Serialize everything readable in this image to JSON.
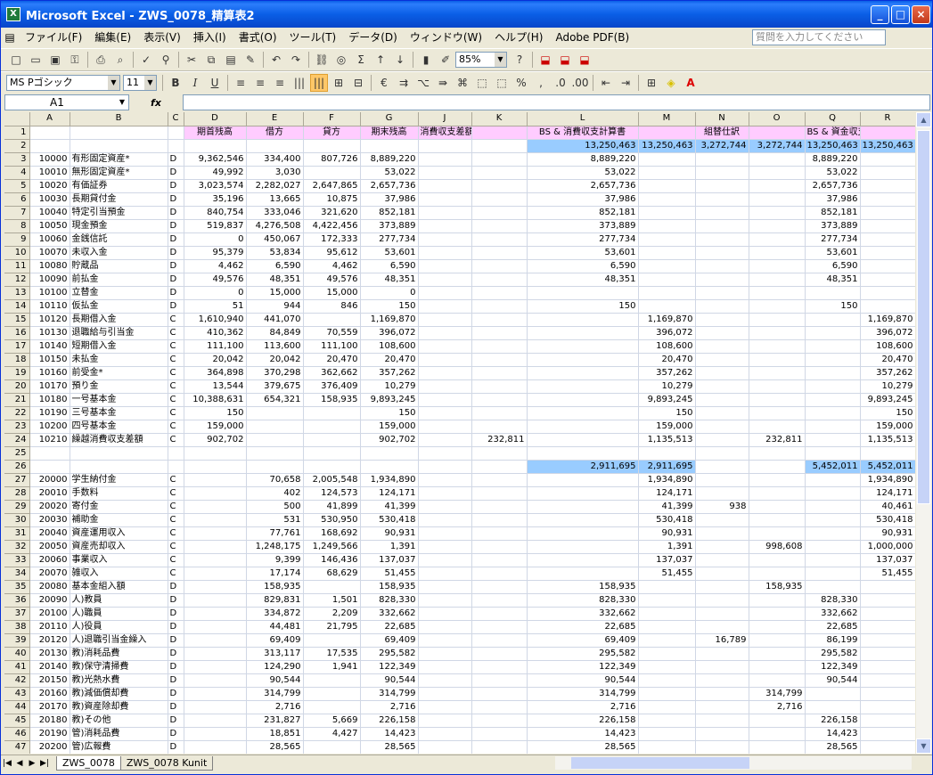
{
  "window": {
    "title": "Microsoft Excel - ZWS_0078_精算表2",
    "minimize": "_",
    "maximize": "□",
    "close": "×"
  },
  "menu": [
    "ファイル(F)",
    "編集(E)",
    "表示(V)",
    "挿入(I)",
    "書式(O)",
    "ツール(T)",
    "データ(D)",
    "ウィンドウ(W)",
    "ヘルプ(H)",
    "Adobe PDF(B)"
  ],
  "help_placeholder": "質問を入力してください",
  "toolbar": {
    "zoom": "85%",
    "font": "MS Pゴシック",
    "size": "11"
  },
  "namebox": "A1",
  "fx": "fx",
  "columns": [
    "",
    "A",
    "B",
    "C",
    "D",
    "E",
    "F",
    "G",
    "J",
    "K",
    "L",
    "M",
    "N",
    "O",
    "Q",
    "R"
  ],
  "rows": [
    [
      "1",
      "",
      "",
      "",
      "期首残高",
      "借方",
      "貸方",
      "期末残高",
      "消費収支差額振替",
      "",
      "BS & 消費収支計算書",
      "",
      "組替仕訳",
      "",
      "BS & 資金収支計算書",
      ""
    ],
    [
      "2",
      "",
      "",
      "",
      "",
      "",
      "",
      "",
      "",
      "",
      "13,250,463",
      "13,250,463",
      "3,272,744",
      "3,272,744",
      "13,250,463",
      "13,250,463"
    ],
    [
      "3",
      "10000",
      "有形固定資産*",
      "D",
      "9,362,546",
      "334,400",
      "807,726",
      "8,889,220",
      "",
      "",
      "8,889,220",
      "",
      "",
      "",
      "8,889,220",
      ""
    ],
    [
      "4",
      "10010",
      "無形固定資産*",
      "D",
      "49,992",
      "3,030",
      "",
      "53,022",
      "",
      "",
      "53,022",
      "",
      "",
      "",
      "53,022",
      ""
    ],
    [
      "5",
      "10020",
      "有価証券",
      "D",
      "3,023,574",
      "2,282,027",
      "2,647,865",
      "2,657,736",
      "",
      "",
      "2,657,736",
      "",
      "",
      "",
      "2,657,736",
      ""
    ],
    [
      "6",
      "10030",
      "長期貸付金",
      "D",
      "35,196",
      "13,665",
      "10,875",
      "37,986",
      "",
      "",
      "37,986",
      "",
      "",
      "",
      "37,986",
      ""
    ],
    [
      "7",
      "10040",
      "特定引当預金",
      "D",
      "840,754",
      "333,046",
      "321,620",
      "852,181",
      "",
      "",
      "852,181",
      "",
      "",
      "",
      "852,181",
      ""
    ],
    [
      "8",
      "10050",
      "現金預金",
      "D",
      "519,837",
      "4,276,508",
      "4,422,456",
      "373,889",
      "",
      "",
      "373,889",
      "",
      "",
      "",
      "373,889",
      ""
    ],
    [
      "9",
      "10060",
      "金銭信託",
      "D",
      "0",
      "450,067",
      "172,333",
      "277,734",
      "",
      "",
      "277,734",
      "",
      "",
      "",
      "277,734",
      ""
    ],
    [
      "10",
      "10070",
      "未収入金",
      "D",
      "95,379",
      "53,834",
      "95,612",
      "53,601",
      "",
      "",
      "53,601",
      "",
      "",
      "",
      "53,601",
      ""
    ],
    [
      "11",
      "10080",
      "貯蔵品",
      "D",
      "4,462",
      "6,590",
      "4,462",
      "6,590",
      "",
      "",
      "6,590",
      "",
      "",
      "",
      "6,590",
      ""
    ],
    [
      "12",
      "10090",
      "前払金",
      "D",
      "49,576",
      "48,351",
      "49,576",
      "48,351",
      "",
      "",
      "48,351",
      "",
      "",
      "",
      "48,351",
      ""
    ],
    [
      "13",
      "10100",
      "立替金",
      "D",
      "0",
      "15,000",
      "15,000",
      "0",
      "",
      "",
      "",
      "",
      "",
      "",
      "",
      ""
    ],
    [
      "14",
      "10110",
      "仮払金",
      "D",
      "51",
      "944",
      "846",
      "150",
      "",
      "",
      "150",
      "",
      "",
      "",
      "150",
      ""
    ],
    [
      "15",
      "10120",
      "長期借入金",
      "C",
      "1,610,940",
      "441,070",
      "",
      "1,169,870",
      "",
      "",
      "",
      "1,169,870",
      "",
      "",
      "",
      "1,169,870"
    ],
    [
      "16",
      "10130",
      "退職給与引当金",
      "C",
      "410,362",
      "84,849",
      "70,559",
      "396,072",
      "",
      "",
      "",
      "396,072",
      "",
      "",
      "",
      "396,072"
    ],
    [
      "17",
      "10140",
      "短期借入金",
      "C",
      "111,100",
      "113,600",
      "111,100",
      "108,600",
      "",
      "",
      "",
      "108,600",
      "",
      "",
      "",
      "108,600"
    ],
    [
      "18",
      "10150",
      "未払金",
      "C",
      "20,042",
      "20,042",
      "20,470",
      "20,470",
      "",
      "",
      "",
      "20,470",
      "",
      "",
      "",
      "20,470"
    ],
    [
      "19",
      "10160",
      "前受金*",
      "C",
      "364,898",
      "370,298",
      "362,662",
      "357,262",
      "",
      "",
      "",
      "357,262",
      "",
      "",
      "",
      "357,262"
    ],
    [
      "20",
      "10170",
      "預り金",
      "C",
      "13,544",
      "379,675",
      "376,409",
      "10,279",
      "",
      "",
      "",
      "10,279",
      "",
      "",
      "",
      "10,279"
    ],
    [
      "21",
      "10180",
      "一号基本金",
      "C",
      "10,388,631",
      "654,321",
      "158,935",
      "9,893,245",
      "",
      "",
      "",
      "9,893,245",
      "",
      "",
      "",
      "9,893,245"
    ],
    [
      "22",
      "10190",
      "三号基本金",
      "C",
      "150",
      "",
      "",
      "150",
      "",
      "",
      "",
      "150",
      "",
      "",
      "",
      "150"
    ],
    [
      "23",
      "10200",
      "四号基本金",
      "C",
      "159,000",
      "",
      "",
      "159,000",
      "",
      "",
      "",
      "159,000",
      "",
      "",
      "",
      "159,000"
    ],
    [
      "24",
      "10210",
      "繰越消費収支差額",
      "C",
      "902,702",
      "",
      "",
      "902,702",
      "",
      "232,811",
      "",
      "1,135,513",
      "",
      "232,811",
      "",
      "1,135,513"
    ],
    [
      "25",
      "",
      "",
      "",
      "",
      "",
      "",
      "",
      "",
      "",
      "",
      "",
      "",
      "",
      "",
      ""
    ],
    [
      "26",
      "",
      "",
      "",
      "",
      "",
      "",
      "",
      "",
      "",
      "2,911,695",
      "2,911,695",
      "",
      "",
      "5,452,011",
      "5,452,011"
    ],
    [
      "27",
      "20000",
      "学生納付金",
      "C",
      "",
      "70,658",
      "2,005,548",
      "1,934,890",
      "",
      "",
      "",
      "1,934,890",
      "",
      "",
      "",
      "1,934,890"
    ],
    [
      "28",
      "20010",
      "手数料",
      "C",
      "",
      "402",
      "124,573",
      "124,171",
      "",
      "",
      "",
      "124,171",
      "",
      "",
      "",
      "124,171"
    ],
    [
      "29",
      "20020",
      "寄付金",
      "C",
      "",
      "500",
      "41,899",
      "41,399",
      "",
      "",
      "",
      "41,399",
      "938",
      "",
      "",
      "40,461"
    ],
    [
      "30",
      "20030",
      "補助金",
      "C",
      "",
      "531",
      "530,950",
      "530,418",
      "",
      "",
      "",
      "530,418",
      "",
      "",
      "",
      "530,418"
    ],
    [
      "31",
      "20040",
      "資産運用収入",
      "C",
      "",
      "77,761",
      "168,692",
      "90,931",
      "",
      "",
      "",
      "90,931",
      "",
      "",
      "",
      "90,931"
    ],
    [
      "32",
      "20050",
      "資産売却収入",
      "C",
      "",
      "1,248,175",
      "1,249,566",
      "1,391",
      "",
      "",
      "",
      "1,391",
      "",
      "998,608",
      "",
      "1,000,000"
    ],
    [
      "33",
      "20060",
      "事業収入",
      "C",
      "",
      "9,399",
      "146,436",
      "137,037",
      "",
      "",
      "",
      "137,037",
      "",
      "",
      "",
      "137,037"
    ],
    [
      "34",
      "20070",
      "雑収入",
      "C",
      "",
      "17,174",
      "68,629",
      "51,455",
      "",
      "",
      "",
      "51,455",
      "",
      "",
      "",
      "51,455"
    ],
    [
      "35",
      "20080",
      "基本金組入額",
      "D",
      "",
      "158,935",
      "",
      "158,935",
      "",
      "",
      "158,935",
      "",
      "",
      "158,935",
      "",
      ""
    ],
    [
      "36",
      "20090",
      "人)教員",
      "D",
      "",
      "829,831",
      "1,501",
      "828,330",
      "",
      "",
      "828,330",
      "",
      "",
      "",
      "828,330",
      ""
    ],
    [
      "37",
      "20100",
      "人)職員",
      "D",
      "",
      "334,872",
      "2,209",
      "332,662",
      "",
      "",
      "332,662",
      "",
      "",
      "",
      "332,662",
      ""
    ],
    [
      "38",
      "20110",
      "人)役員",
      "D",
      "",
      "44,481",
      "21,795",
      "22,685",
      "",
      "",
      "22,685",
      "",
      "",
      "",
      "22,685",
      ""
    ],
    [
      "39",
      "20120",
      "人)退職引当金繰入",
      "D",
      "",
      "69,409",
      "",
      "69,409",
      "",
      "",
      "69,409",
      "",
      "16,789",
      "",
      "86,199",
      ""
    ],
    [
      "40",
      "20130",
      "教)消耗品費",
      "D",
      "",
      "313,117",
      "17,535",
      "295,582",
      "",
      "",
      "295,582",
      "",
      "",
      "",
      "295,582",
      ""
    ],
    [
      "41",
      "20140",
      "教)保守清掃費",
      "D",
      "",
      "124,290",
      "1,941",
      "122,349",
      "",
      "",
      "122,349",
      "",
      "",
      "",
      "122,349",
      ""
    ],
    [
      "42",
      "20150",
      "教)光熱水費",
      "D",
      "",
      "90,544",
      "",
      "90,544",
      "",
      "",
      "90,544",
      "",
      "",
      "",
      "90,544",
      ""
    ],
    [
      "43",
      "20160",
      "教)減価償却費",
      "D",
      "",
      "314,799",
      "",
      "314,799",
      "",
      "",
      "314,799",
      "",
      "",
      "314,799",
      "",
      ""
    ],
    [
      "44",
      "20170",
      "教)資産除却費",
      "D",
      "",
      "2,716",
      "",
      "2,716",
      "",
      "",
      "2,716",
      "",
      "",
      "2,716",
      "",
      ""
    ],
    [
      "45",
      "20180",
      "教)その他",
      "D",
      "",
      "231,827",
      "5,669",
      "226,158",
      "",
      "",
      "226,158",
      "",
      "",
      "",
      "226,158",
      ""
    ],
    [
      "46",
      "20190",
      "管)消耗品費",
      "D",
      "",
      "18,851",
      "4,427",
      "14,423",
      "",
      "",
      "14,423",
      "",
      "",
      "",
      "14,423",
      ""
    ],
    [
      "47",
      "20200",
      "管)広報費",
      "D",
      "",
      "28,565",
      "",
      "28,565",
      "",
      "",
      "28,565",
      "",
      "",
      "",
      "28,565",
      ""
    ]
  ],
  "sheets": [
    "ZWS_0078",
    "ZWS_0078 Kunit"
  ]
}
